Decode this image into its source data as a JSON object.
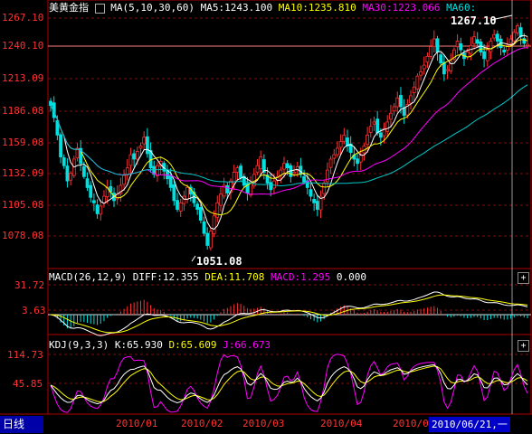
{
  "period_label": "日线",
  "cursor_date": "2010/06/21,一",
  "price_panel": {
    "title": "美黄金指",
    "ma_params": "MA(5,10,30,60)",
    "ma5": "MA5:1243.100",
    "ma10": "MA10:1235.810",
    "ma30": "MA30:1223.066",
    "ma60": "MA60:",
    "y_ticks": [
      "1267.10",
      "1240.10",
      "1213.09",
      "1186.08",
      "1159.08",
      "1132.09",
      "1105.08",
      "1078.08"
    ],
    "high_label": "1267.10",
    "low_label": "1051.08"
  },
  "macd_panel": {
    "params": "MACD(26,12,9)",
    "diff": "DIFF:12.355",
    "dea": "DEA:11.708",
    "macd": "MACD:1.295",
    "zero": "0.000",
    "y_ticks": [
      "31.72",
      "3.63"
    ]
  },
  "kdj_panel": {
    "params": "KDJ(9,3,3)",
    "k": "K:65.930",
    "d": "D:65.609",
    "j": "J:66.673",
    "y_ticks": [
      "114.73",
      "45.85"
    ]
  },
  "x_ticks": [
    "2010/01",
    "2010/02",
    "2010/03",
    "2010/04",
    "2010/05"
  ],
  "colors": {
    "up": "#ff3232",
    "down": "#00e0e0",
    "ma5": "#ffffff",
    "ma10": "#ffff00",
    "ma30": "#ff00ff",
    "ma60": "#00c8c8",
    "grid": "#a00000"
  },
  "chart_data": {
    "type": "candlestick",
    "title": "美黄金指",
    "x_ticks": [
      "2010/01",
      "2010/02",
      "2010/03",
      "2010/04",
      "2010/05"
    ],
    "price_ylim": [
      1051.08,
      1267.1
    ],
    "closes": [
      1187,
      1176,
      1160,
      1140,
      1132,
      1118,
      1125,
      1138,
      1148,
      1134,
      1122,
      1112,
      1103,
      1098,
      1088,
      1095,
      1104,
      1112,
      1108,
      1100,
      1106,
      1114,
      1123,
      1130,
      1142,
      1138,
      1145,
      1150,
      1158,
      1143,
      1130,
      1124,
      1132,
      1136,
      1127,
      1120,
      1112,
      1100,
      1092,
      1098,
      1104,
      1112,
      1106,
      1098,
      1092,
      1082,
      1070,
      1059,
      1072,
      1086,
      1098,
      1106,
      1114,
      1107,
      1118,
      1126,
      1130,
      1121,
      1114,
      1107,
      1116,
      1124,
      1132,
      1140,
      1126,
      1116,
      1110,
      1118,
      1122,
      1128,
      1134,
      1130,
      1122,
      1126,
      1131,
      1124,
      1117,
      1112,
      1104,
      1098,
      1092,
      1104,
      1116,
      1128,
      1138,
      1142,
      1148,
      1154,
      1160,
      1150,
      1144,
      1138,
      1134,
      1142,
      1150,
      1160,
      1168,
      1172,
      1162,
      1158,
      1166,
      1172,
      1180,
      1186,
      1194,
      1186,
      1178,
      1188,
      1196,
      1204,
      1214,
      1218,
      1224,
      1232,
      1241,
      1248,
      1236,
      1226,
      1216,
      1220,
      1228,
      1238,
      1246,
      1238,
      1230,
      1236,
      1242,
      1250,
      1244,
      1236,
      1230,
      1238,
      1246,
      1252,
      1246,
      1240,
      1236,
      1242,
      1248,
      1254,
      1260,
      1250,
      1244,
      1243
    ],
    "ma5": "1243.100",
    "ma10": "1235.810",
    "ma30": "1223.066",
    "macd": {
      "diff": 12.355,
      "dea": 11.708,
      "macd": 1.295,
      "ylim": [
        -20,
        31.72
      ]
    },
    "kdj": {
      "k": 65.93,
      "d": 65.609,
      "j": 66.673,
      "ylim": [
        0,
        114.73
      ]
    }
  }
}
